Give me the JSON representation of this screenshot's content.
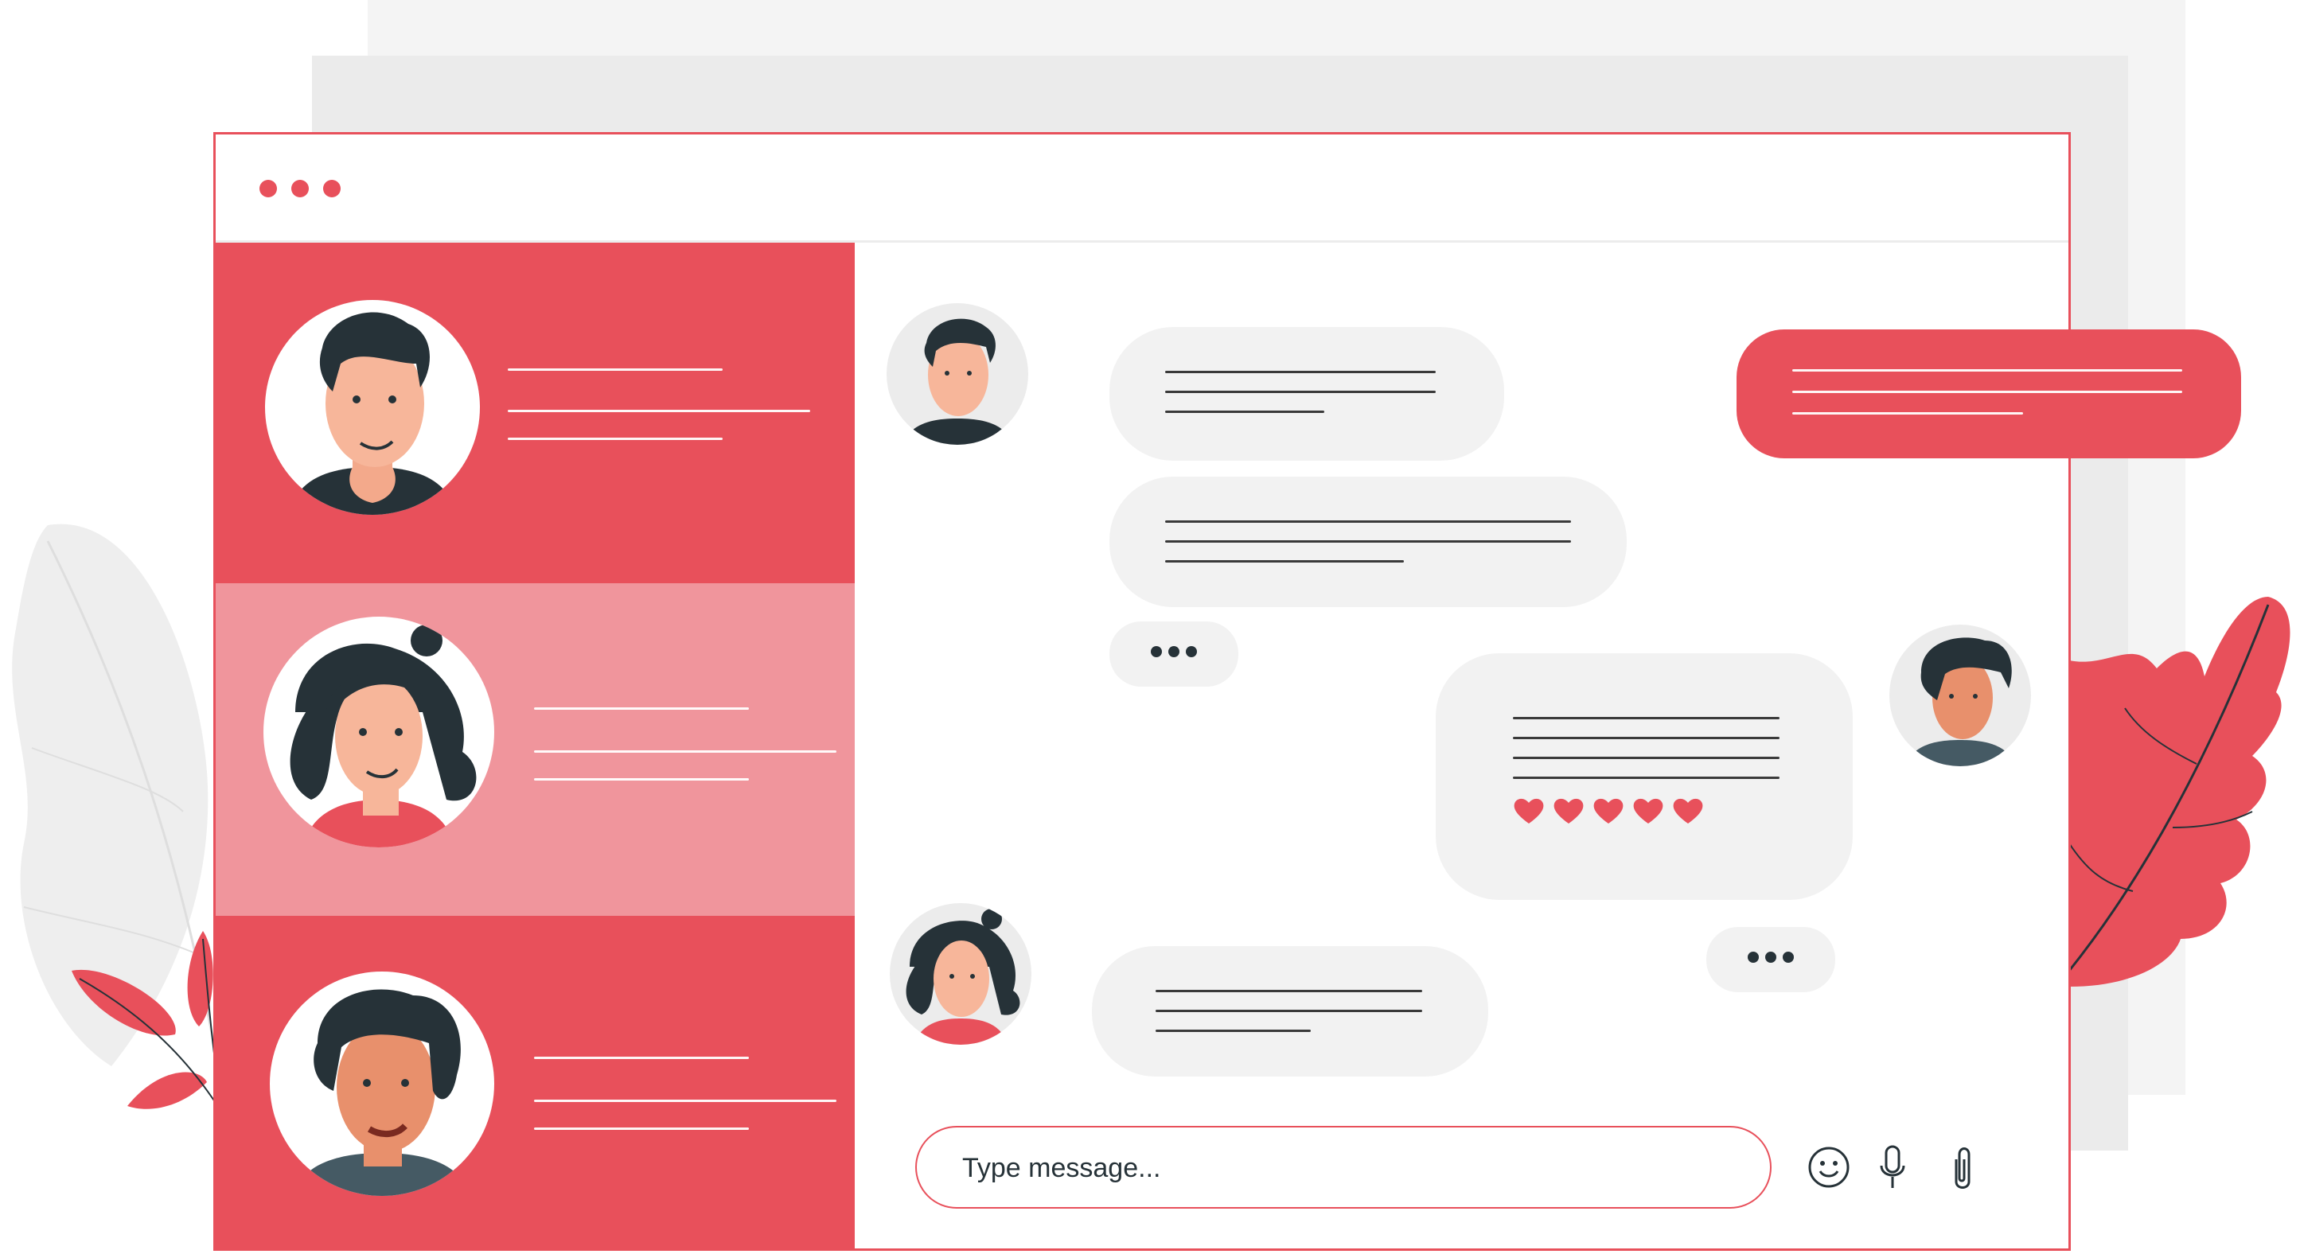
{
  "composer": {
    "placeholder": "Type message...",
    "emoji_icon": "smiley-icon",
    "mic_icon": "microphone-icon",
    "attach_icon": "paperclip-icon"
  },
  "colors": {
    "accent": "#e8505b",
    "accent_light": "#f0959c",
    "bubble": "#f2f2f2",
    "dark": "#263238"
  },
  "contacts": [
    {
      "avatar": "man-avatar",
      "active": false
    },
    {
      "avatar": "woman-avatar",
      "active": true
    },
    {
      "avatar": "curly-man-avatar",
      "active": false
    }
  ],
  "reactions": {
    "icon": "heart-icon",
    "count": 5
  }
}
